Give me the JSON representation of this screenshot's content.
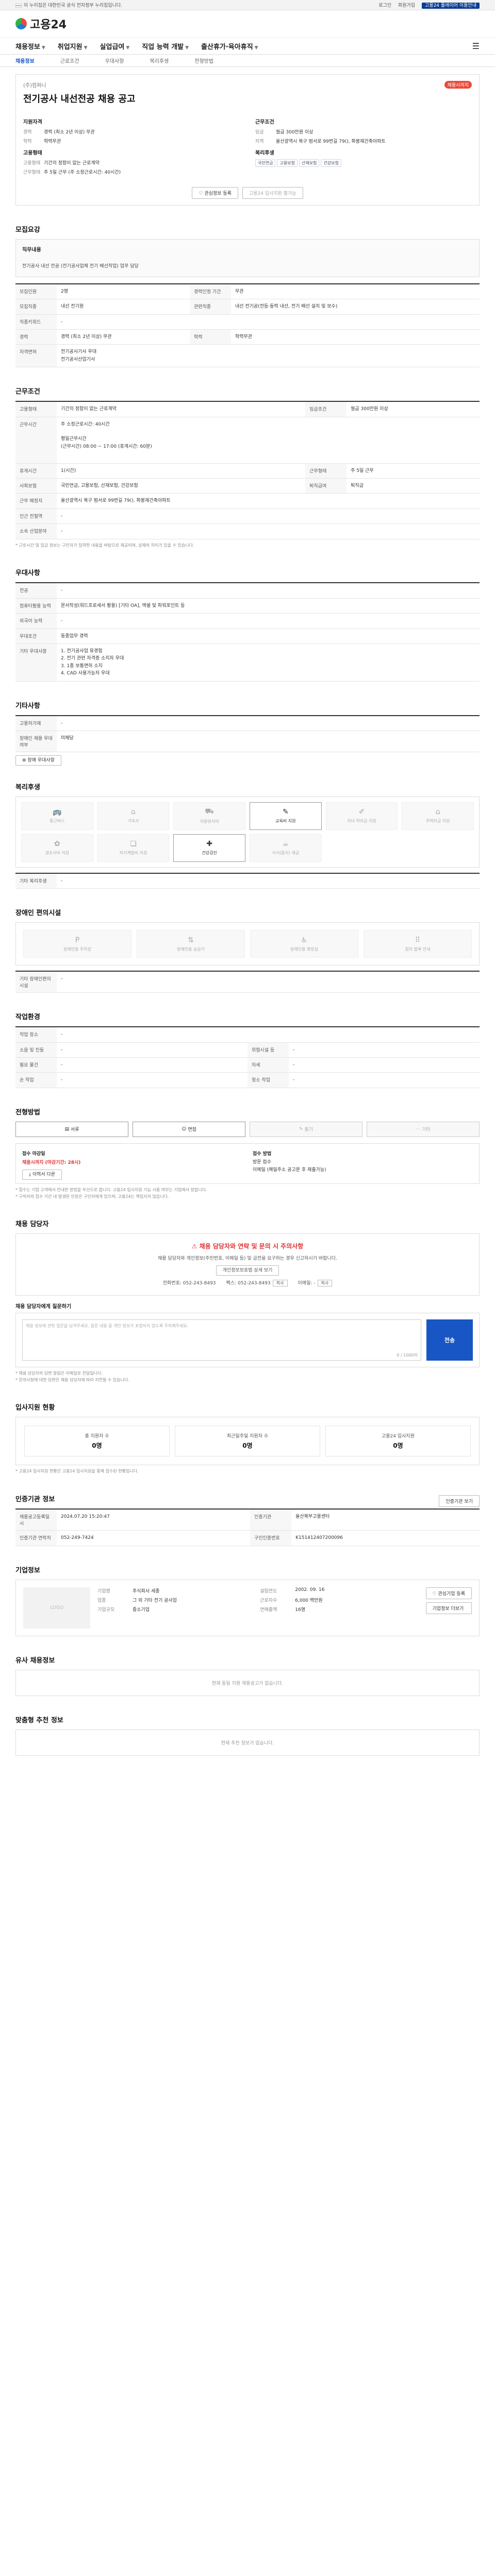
{
  "govbar": {
    "left": "이 누리집은 대한민국 공식 전자정부 누리집입니다.",
    "right": [
      "로그인",
      "회원가입"
    ],
    "btn": "고용24 플레이어 이용안내"
  },
  "header": {
    "logo": "고용24"
  },
  "nav": {
    "items": [
      "채용정보",
      "취업지원",
      "실업급여",
      "직업 능력 개발",
      "출산휴가·육아휴직"
    ],
    "active": 0
  },
  "subnav": {
    "items": [
      "채용정보",
      "근로조건",
      "우대사항",
      "복리후생",
      "전형방법"
    ]
  },
  "title": {
    "company_label": "(주)컴퍼니",
    "dday": "채용시까지",
    "job_title": "전기공사 내선전공 채용 공고",
    "sum_left_h": "지원자격",
    "sum_right_h": "근무조건",
    "left": [
      {
        "k": "경력",
        "v": "경력 (최소 2년 이상) 무관"
      },
      {
        "k": "학력",
        "v": "학력무관"
      }
    ],
    "right": [
      {
        "k": "임금",
        "v": "월급 300만원 이상"
      },
      {
        "k": "지역",
        "v": "울산광역시 북구 범서로 99번길 79(), 화봉재건축아파트"
      }
    ],
    "left2_h": "고용형태",
    "right2_h": "복리후생",
    "left2": [
      {
        "k": "고용형태",
        "v": "기간의 정함이 없는 근로계약"
      },
      {
        "k": "근무형태",
        "v": "주 5일 근무 (주 소정근로시간: 40시간)"
      }
    ],
    "chips": [
      "국민연금",
      "고용보험",
      "산재보험",
      "건강보험"
    ],
    "btn_save": "관심정보 등록",
    "btn_apply": "고용24 입사지원 불가능"
  },
  "duty": {
    "h": "모집요강",
    "title": "직무내용",
    "text": "전기공사 내선 전공 (전기공사업체 전기 배선작업) 업무 담당"
  },
  "recruit": {
    "rows": [
      {
        "k": "모집인원",
        "v": "2명",
        "k2": "경력인정 기간",
        "v2": "무관"
      },
      {
        "k": "모집직종",
        "v": "내선 전기원",
        "k2": "관련직종",
        "v2": "내선 전기공(전등·동력 내선, 전기 배선 설치 및 보수)"
      },
      {
        "k": "직종키워드",
        "v": "-",
        "k2": "",
        "v2": ""
      },
      {
        "k": "경력",
        "v": "경력 (최소 2년 이상) 무관",
        "k2": "학력",
        "v2": "학력무관"
      },
      {
        "k": "자격면허",
        "v": "전기공사기사 우대\n전기공사산업기사",
        "k2": "",
        "v2": ""
      }
    ]
  },
  "conditions": {
    "h": "근무조건",
    "rows": [
      {
        "k": "고용형태",
        "v": "기간의 정함이 없는 근로계약",
        "k2": "임금조건",
        "v2": "월급 300만원 이상"
      },
      {
        "k": "근무시간",
        "v": "주 소정근로시간: 40시간\n\n평일근무시간\n(근무시간) 08:00 ~ 17:00 (휴게시간: 60분)",
        "k2": "",
        "v2": ""
      },
      {
        "k": "휴게시간",
        "v": "1(시간)",
        "k2": "근무형태",
        "v2": "주 5일 근무"
      },
      {
        "k": "사회보험",
        "v": "국민연금, 고용보험, 산재보험, 건강보험",
        "k2": "퇴직급여",
        "v2": "퇴직금"
      },
      {
        "k": "근무 예정지",
        "v": "울산광역시 북구 범서로 99번길 79(), 화봉재건축아파트",
        "k2": "",
        "v2": ""
      },
      {
        "k": "인근 전철역",
        "v": "-",
        "k2": "",
        "v2": ""
      },
      {
        "k": "소속 산업분야",
        "v": "-",
        "k2": "",
        "v2": ""
      }
    ],
    "note": "* 근로시간 및 임금 정보는 구인자가 입력한 내용을 바탕으로 제공되며, 실제와 차이가 있을 수 있습니다."
  },
  "prefer": {
    "h": "우대사항",
    "rows": [
      {
        "k": "전공",
        "v": "-"
      },
      {
        "k": "컴퓨터활용 능력",
        "v": "문서작성(워드프로세서 활용) [기타 OA], 엑셀 및 파워포인트 등"
      },
      {
        "k": "외국어 능력",
        "v": "-"
      },
      {
        "k": "우대조건",
        "v": "동종업무 경력"
      },
      {
        "k": "기타 우대사항",
        "v": "1. 전기공사업 유경험\n2. 전기 관련 자격증 소지자 우대\n3. 1종 보통면허 소지\n4. CAD 사용가능자 우대"
      }
    ]
  },
  "disability": {
    "h": "기타사항",
    "rows": [
      {
        "k": "고용허가제",
        "v": "-"
      },
      {
        "k": "장애인 채용 우대 여부",
        "v": "미해당"
      }
    ],
    "link": "장애 우대사항"
  },
  "welfare": {
    "h": "복리후생",
    "items": [
      "통근버스",
      "기숙사",
      "차량유지비",
      "교육비 지원",
      "자녀 학자금 지원",
      "주택자금 지원",
      "경조사비 지원",
      "자기계발비 지원",
      "건강검진",
      "식사(중식) 제공",
      "",
      ""
    ],
    "on": [
      3,
      8
    ],
    "row_label": "기타 복리후생",
    "row_value": "-"
  },
  "facility": {
    "h": "장애인 편의시설",
    "items": [
      "장애인용 주차장",
      "장애인용 승강기",
      "장애인용 화장실",
      "점자 블록 안내"
    ],
    "row_label": "기타 장애인편의 시설",
    "row_value": "-"
  },
  "env": {
    "h": "작업환경",
    "rows": [
      {
        "k": "작업 장소",
        "v": "-",
        "k2": "",
        "v2": ""
      },
      {
        "k": "소음 및 진동",
        "v": "-",
        "k2": "위험시설 등",
        "v2": "-"
      },
      {
        "k": "필요 물건",
        "v": "-",
        "k2": "자세",
        "v2": "-"
      },
      {
        "k": "손 작업",
        "v": "-",
        "k2": "청소 작업",
        "v2": "-"
      }
    ]
  },
  "method": {
    "h": "전형방법",
    "steps": [
      "서류",
      "면접",
      "필기",
      "기타"
    ],
    "on": [
      0,
      1
    ]
  },
  "apply": {
    "k1": "접수 마감일",
    "v1": "채용시까지 (마감기간: 28시)",
    "k2": "접수 방법",
    "v2": "방문 접수\n이메일 (메일주소 공고문 후 제출가능)",
    "btn": "이력서 다운",
    "notes": [
      "* 접수는 기업 고객에서 안내한 방법을 우선으로 합니다. 고용24 입사지원 기능 사용 여부는 기업에서 정합니다.",
      "* 구직자의 접수 기간 내 발생된 민원은 구인자에게 있으며, 고용24는 책임지지 않습니다."
    ]
  },
  "contact": {
    "h": "채용 담당자",
    "warn_title": "채용 담당자와 연락 및 문의 시 주의사항",
    "warn_text": "채용 담당자와 개인정보(주민번호, 이메일 등) 및 금전을 요구하는 경우 신고하시기 바랍니다.",
    "warn_btn": "개인정보보호법 상세 보기",
    "phone_label": "전화번호",
    "phone": "052-243-8493",
    "fax_label": "팩스",
    "fax": "052-243-8493",
    "mail_label": "이메일",
    "mail": "-",
    "copy": "복사",
    "msg_h": "채용 담당자에게 질문하기",
    "msg_ph": "채용 정보에 관한 질문을 남겨주세요. 질문 내용 중 개인 정보가 포함되지 않도록 주의해주세요.",
    "msg_count": "0 / 1000자",
    "send": "전송",
    "msg_notes": [
      "* 채용 담당자의 답변 알림은 이메일로 전달됩니다.",
      "* 문의사항에 대한 답변은 채용 담당자에 따라 지연될 수 있습니다."
    ]
  },
  "stats": {
    "h": "입사지원 현황",
    "items": [
      {
        "label": "총 지원자 수",
        "value": "0명"
      },
      {
        "label": "최근일주일 지원자 수",
        "value": "0명"
      },
      {
        "label": "고용24 입사지원",
        "value": "0명"
      }
    ],
    "note": "* 고용24 입사지원 현황은 고용24 입사지원을 통해 접수된 현황입니다."
  },
  "agency": {
    "h": "인증기관 정보",
    "rows": [
      {
        "k": "채용공고등록일시",
        "v": "2024.07.20 15:20:47",
        "k2": "인증기관",
        "v2": "울산북부고용센터"
      },
      {
        "k": "인증기관 연락처",
        "v": "052-249-7424",
        "k2": "구인인증번호",
        "v2": "K151412407200096"
      }
    ],
    "btn": "인증기관 보기"
  },
  "company": {
    "h": "기업정보",
    "logo": "LOGO",
    "rows": [
      {
        "k": "기업명",
        "v": "주식회사 세종",
        "k2": "설립연도",
        "v2": "2002. 09. 16"
      },
      {
        "k": "업종",
        "v": "그 외 기타 전기 공사업",
        "k2": "근로자수",
        "v2": "6,000 백만원"
      },
      {
        "k": "기업규모",
        "v": "중소기업",
        "k2": "연매출액",
        "v2": "16명"
      }
    ],
    "btn_fav": "관심기업 등록",
    "btn_more": "기업정보 더보기"
  },
  "similar": {
    "h": "유사 채용정보",
    "empty": "현재 동일 지원 채용공고가 없습니다."
  },
  "recommend": {
    "h": "맞춤형 추천 정보",
    "empty": "현재 추천 정보가 없습니다."
  },
  "colors": {
    "brand": "#1756c4",
    "alert": "#e03131"
  }
}
